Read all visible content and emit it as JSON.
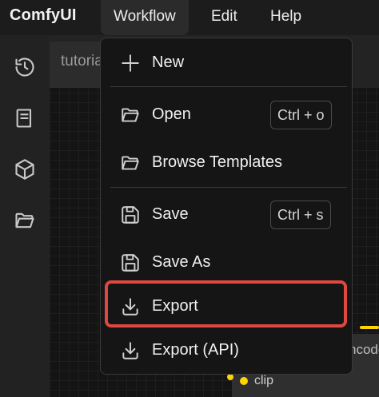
{
  "app": {
    "brand": "ComfyUI"
  },
  "menubar": {
    "items": [
      {
        "label": "Workflow",
        "active": true
      },
      {
        "label": "Edit",
        "active": false
      },
      {
        "label": "Help",
        "active": false
      }
    ]
  },
  "sidebar": {
    "icons": [
      "history-icon",
      "book-icon",
      "cube-icon",
      "folder-open-icon"
    ]
  },
  "workspace": {
    "tab_label": "tutorial",
    "node_title": "ncode",
    "node_input_label": "clip"
  },
  "workflow_menu": {
    "items": [
      {
        "label": "New",
        "icon": "plus-icon",
        "shortcut": ""
      },
      {
        "label": "Open",
        "icon": "folder-open-icon",
        "shortcut": "Ctrl + o"
      },
      {
        "label": "Browse Templates",
        "icon": "folder-open-icon",
        "shortcut": ""
      },
      {
        "label": "Save",
        "icon": "floppy-disk-icon",
        "shortcut": "Ctrl + s"
      },
      {
        "label": "Save As",
        "icon": "floppy-disk-icon",
        "shortcut": ""
      },
      {
        "label": "Export",
        "icon": "download-icon",
        "shortcut": "",
        "highlighted": true
      },
      {
        "label": "Export (API)",
        "icon": "download-icon",
        "shortcut": ""
      }
    ]
  },
  "colors": {
    "highlight": "#e0473f",
    "link": "#ffd500"
  }
}
